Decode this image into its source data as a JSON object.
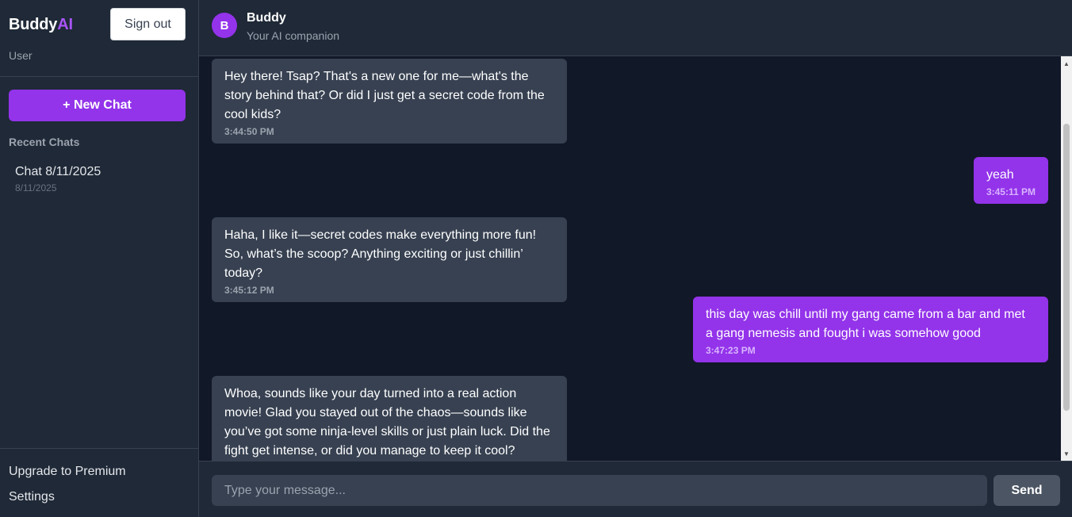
{
  "sidebar": {
    "logo_main": "Buddy",
    "logo_accent": "AI",
    "sign_out_label": "Sign out",
    "user_label": "User",
    "new_chat_label": "+ New Chat",
    "recent_title": "Recent Chats",
    "recent_chats": [
      {
        "title": "Chat 8/11/2025",
        "date": "8/11/2025"
      }
    ],
    "upgrade_label": "Upgrade to Premium",
    "settings_label": "Settings"
  },
  "header": {
    "avatar_letter": "B",
    "name": "Buddy",
    "subtitle": "Your AI companion"
  },
  "messages": [
    {
      "role": "bot",
      "text": "Hey there! Tsap? That's a new one for me—what's the story behind that? Or did I just get a secret code from the cool kids?",
      "time": "3:44:50 PM"
    },
    {
      "role": "user",
      "text": "yeah",
      "time": "3:45:11 PM"
    },
    {
      "role": "bot",
      "text": "Haha, I like it—secret codes make everything more fun! So, what’s the scoop? Anything exciting or just chillin’ today?",
      "time": "3:45:12 PM"
    },
    {
      "role": "user",
      "text": "this day was chill until my gang came from a bar and met a gang nemesis and fought i was somehow good",
      "time": "3:47:23 PM"
    },
    {
      "role": "bot",
      "text": "Whoa, sounds like your day turned into a real action movie! Glad you stayed out of the chaos—sounds like you’ve got some ninja-level skills or just plain luck. Did the fight get intense, or did you manage to keep it cool?",
      "time": ""
    }
  ],
  "composer": {
    "placeholder": "Type your message...",
    "value": "",
    "send_label": "Send"
  },
  "colors": {
    "accent": "#9333ea",
    "sidebar_bg": "#1f2937",
    "chat_bg": "#111827",
    "bot_bubble": "#374151"
  }
}
